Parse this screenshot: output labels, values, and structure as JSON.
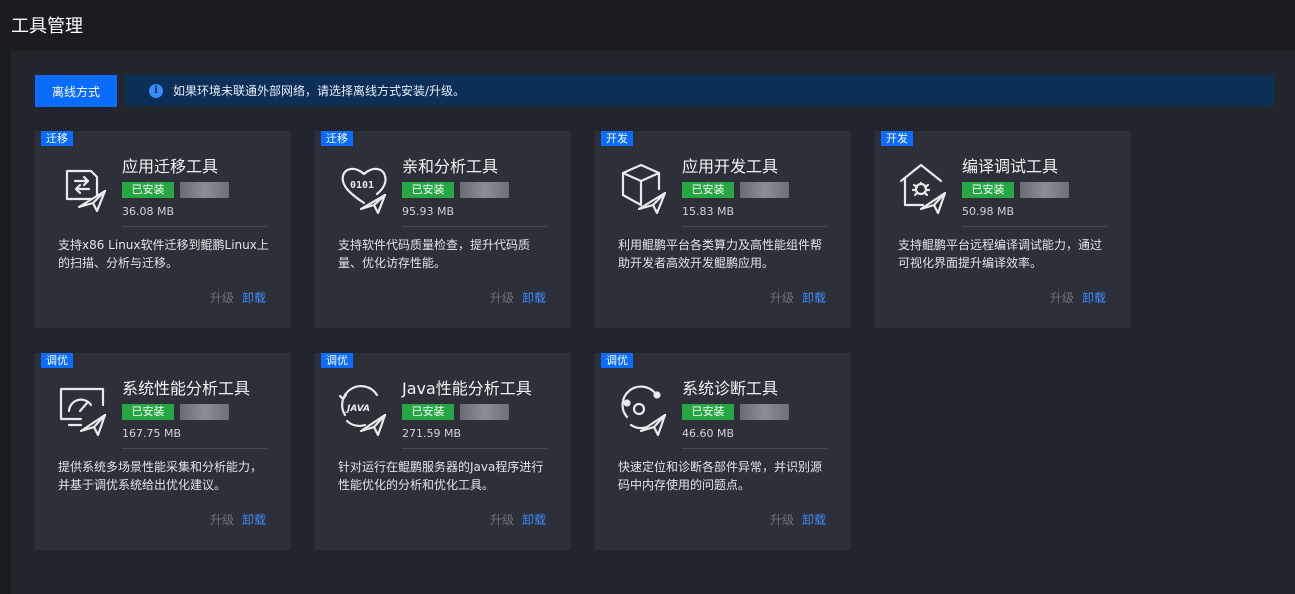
{
  "header": {
    "title": "工具管理"
  },
  "toolbar": {
    "offline_label": "离线方式",
    "notice_text": "如果环境未联通外部网络，请选择离线方式安装/升级。"
  },
  "colors": {
    "accent": "#0a6cff",
    "installed": "#27a744",
    "notice_bg": "#0b2f57",
    "card_bg": "#2d3038"
  },
  "tools": [
    {
      "tag": "迁移",
      "name": "应用迁移工具",
      "status": "已安装",
      "size": "36.08 MB",
      "description": "支持x86 Linux软件迁移到鲲鹏Linux上的扫描、分析与迁移。",
      "upgrade": "升级",
      "uninstall": "卸载",
      "icon": "migrate-doc-icon"
    },
    {
      "tag": "迁移",
      "name": "亲和分析工具",
      "status": "已安装",
      "size": "95.93 MB",
      "description": "支持软件代码质量检查，提升代码质量、优化访存性能。",
      "upgrade": "升级",
      "uninstall": "卸载",
      "icon": "binary-heart-icon"
    },
    {
      "tag": "开发",
      "name": "应用开发工具",
      "status": "已安装",
      "size": "15.83 MB",
      "description": "利用鲲鹏平台各类算力及高性能组件帮助开发者高效开发鲲鹏应用。",
      "upgrade": "升级",
      "uninstall": "卸载",
      "icon": "cube-icon"
    },
    {
      "tag": "开发",
      "name": "编译调试工具",
      "status": "已安装",
      "size": "50.98 MB",
      "description": "支持鲲鹏平台远程编译调试能力，通过可视化界面提升编译效率。",
      "upgrade": "升级",
      "uninstall": "卸载",
      "icon": "bug-house-icon"
    },
    {
      "tag": "调优",
      "name": "系统性能分析工具",
      "status": "已安装",
      "size": "167.75 MB",
      "description": "提供系统多场景性能采集和分析能力，并基于调优系统给出优化建议。",
      "upgrade": "升级",
      "uninstall": "卸载",
      "icon": "monitor-gauge-icon"
    },
    {
      "tag": "调优",
      "name": "Java性能分析工具",
      "status": "已安装",
      "size": "271.59 MB",
      "description": "针对运行在鲲鹏服务器的Java程序进行性能优化的分析和优化工具。",
      "upgrade": "升级",
      "uninstall": "卸载",
      "icon": "java-gauge-icon"
    },
    {
      "tag": "调优",
      "name": "系统诊断工具",
      "status": "已安装",
      "size": "46.60 MB",
      "description": "快速定位和诊断各部件异常，并识别源码中内存使用的问题点。",
      "upgrade": "升级",
      "uninstall": "卸载",
      "icon": "diagnosis-orbit-icon"
    }
  ]
}
